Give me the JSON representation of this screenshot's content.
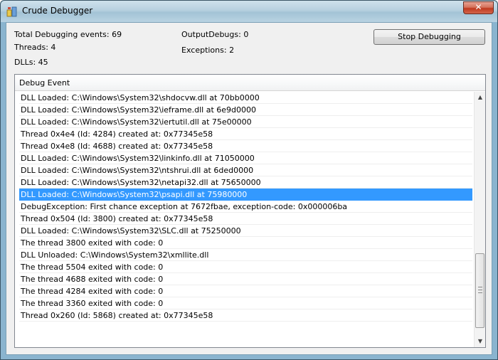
{
  "window": {
    "title": "Crude Debugger",
    "close_label": "✕"
  },
  "stats": {
    "total_events": "Total Debugging events: 69",
    "threads": "Threads: 4",
    "dlls": "DLLs: 45",
    "output_debugs": "OutputDebugs: 0",
    "exceptions": "Exceptions: 2"
  },
  "toolbar": {
    "stop_label": "Stop Debugging"
  },
  "event_list": {
    "column_header": "Debug Event",
    "selected_index": 8,
    "rows": [
      "DLL Loaded: C:\\Windows\\System32\\shdocvw.dll at 70bb0000",
      "DLL Loaded: C:\\Windows\\System32\\ieframe.dll at 6e9d0000",
      "DLL Loaded: C:\\Windows\\System32\\iertutil.dll at 75e00000",
      "Thread 0x4e4 (Id: 4284) created at: 0x77345e58",
      "Thread 0x4e8 (Id: 4688) created at: 0x77345e58",
      "DLL Loaded: C:\\Windows\\System32\\linkinfo.dll at 71050000",
      "DLL Loaded: C:\\Windows\\System32\\ntshrui.dll at 6ded0000",
      "DLL Loaded: C:\\Windows\\System32\\netapi32.dll at 75650000",
      "DLL Loaded: C:\\Windows\\System32\\psapi.dll at 75980000",
      "DebugException: First chance exception at 7672fbae, exception-code: 0x000006ba",
      "Thread 0x504 (Id: 3800) created at: 0x77345e58",
      "DLL Loaded: C:\\Windows\\System32\\SLC.dll at 75250000",
      "The thread 3800 exited with code: 0",
      "DLL Unloaded: C:\\Windows\\System32\\xmllite.dll",
      "The thread 5504 exited with code: 0",
      "The thread 4688 exited with code: 0",
      "The thread 4284 exited with code: 0",
      "The thread 3360 exited with code: 0",
      "Thread 0x260 (Id: 5868) created at: 0x77345e58"
    ]
  },
  "scrollbar": {
    "up_icon": "▲",
    "down_icon": "▼"
  },
  "colors": {
    "selection": "#3399ff",
    "close_button": "#c0391f"
  }
}
